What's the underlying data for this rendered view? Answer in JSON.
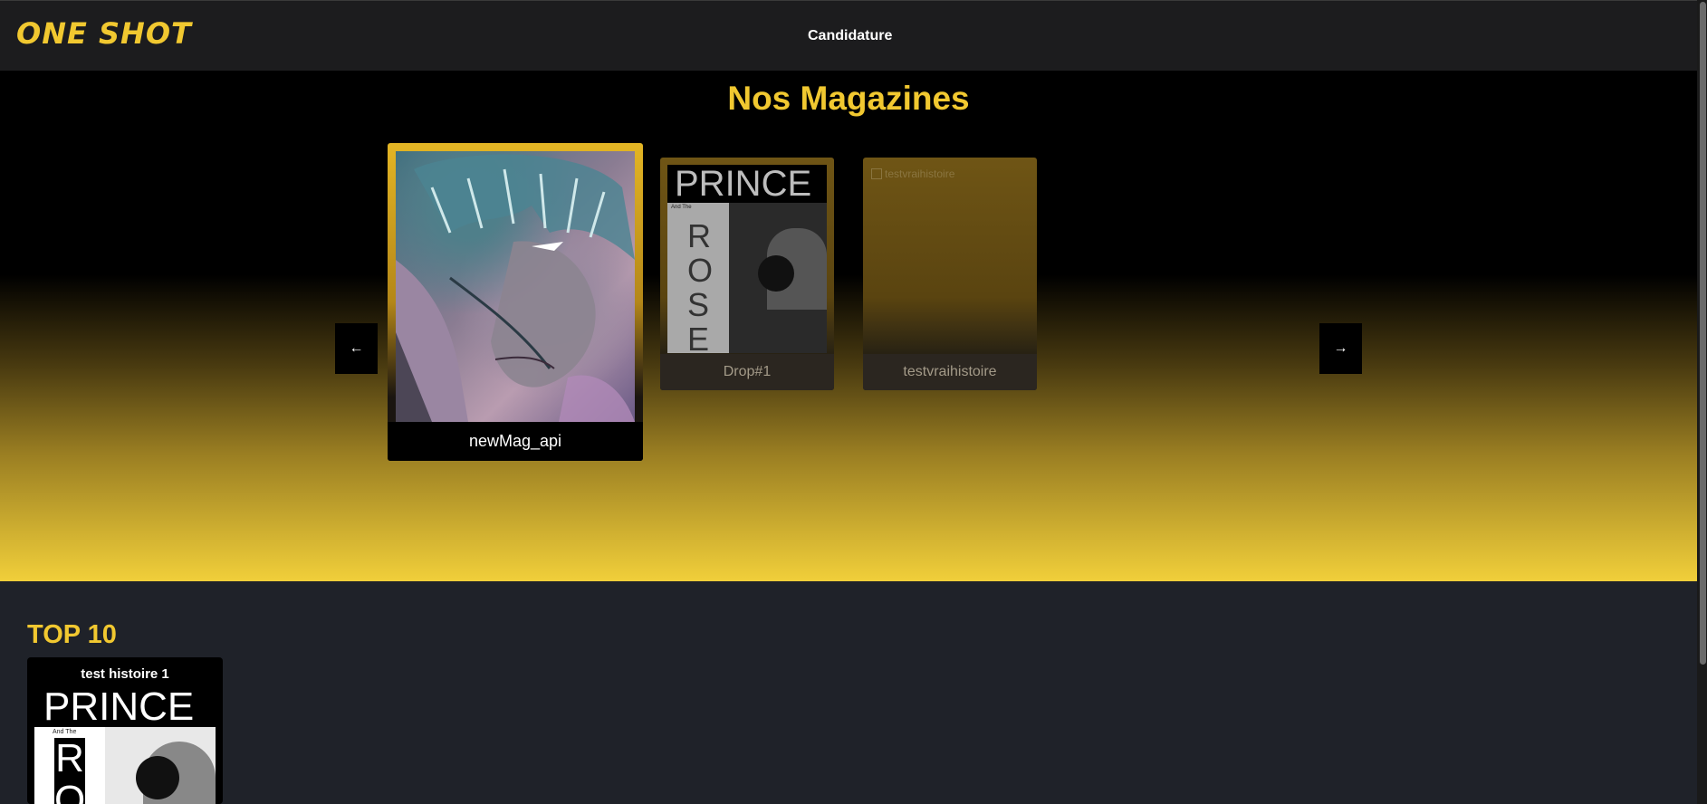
{
  "header": {
    "logo_text": "ONE SHOT",
    "nav_link": "Candidature",
    "brand_color": "#f1c830"
  },
  "hero": {
    "title": "Nos Magazines",
    "prev_icon": "arrow-left-icon",
    "next_icon": "arrow-right-icon",
    "magazines": [
      {
        "name": "newMag_api",
        "active": true
      },
      {
        "name": "Drop#1",
        "active": false
      },
      {
        "name": "testvraihistoire",
        "active": false,
        "image_alt": "testvraihistoire"
      }
    ]
  },
  "top10": {
    "title": "TOP 10",
    "items": [
      {
        "title": "test histoire 1"
      }
    ]
  },
  "cover_text": {
    "prince": "PRINCE",
    "and_the": "And The",
    "rose_letters": [
      "R",
      "O",
      "S",
      "E"
    ]
  }
}
